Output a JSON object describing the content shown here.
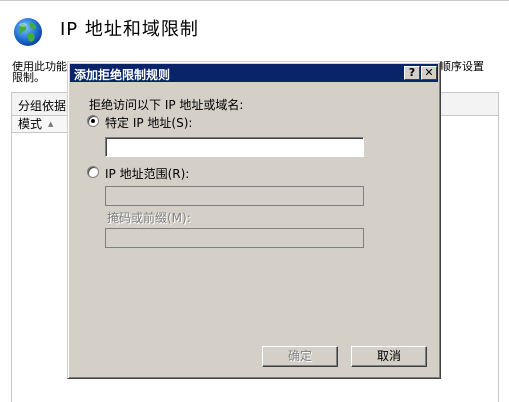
{
  "page": {
    "title": "IP 地址和域限制",
    "description_left_line1": "使用此功能",
    "description_left_line2": "限制。",
    "description_right": "顺序设置",
    "groupby_label": "分组依据",
    "column_header": "模式"
  },
  "dialog": {
    "title": "添加拒绝限制规则",
    "help_button": "?",
    "close_button": "✕",
    "prompt": "拒绝访问以下 IP 地址或域名:",
    "option_specific": "特定 IP 地址(S):",
    "option_specific_checked": true,
    "specific_value": "",
    "option_range": "IP 地址范围(R):",
    "option_range_checked": false,
    "range_value": "",
    "mask_label": "掩码或前缀(M):",
    "mask_value": "",
    "ok_button": "确定",
    "cancel_button": "取消"
  },
  "colors": {
    "titlebar": "#0a246a",
    "dialog_face": "#d4d0c8"
  }
}
